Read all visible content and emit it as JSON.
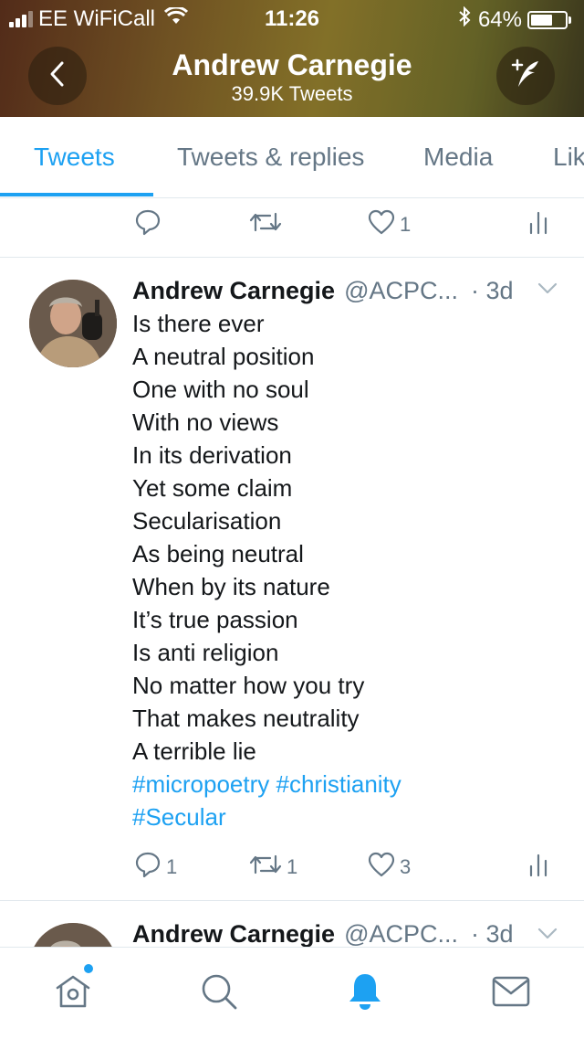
{
  "status_bar": {
    "carrier": "EE WiFiCall",
    "time": "11:26",
    "battery": "64%",
    "battery_level": 0.64
  },
  "header": {
    "title": "Andrew Carnegie",
    "subtitle": "39.9K Tweets",
    "back_icon": "chevron-left-icon",
    "compose_icon": "compose-feather-icon"
  },
  "tabs": [
    {
      "label": "Tweets",
      "active": true
    },
    {
      "label": "Tweets & replies",
      "active": false
    },
    {
      "label": "Media",
      "active": false
    },
    {
      "label": "Lik",
      "active": false
    }
  ],
  "previous_tweet_actions": {
    "reply_count": "",
    "retweet_count": "",
    "like_count": "1"
  },
  "tweet": {
    "name": "Andrew Carnegie",
    "handle": "@ACPC...",
    "time": "· 3d",
    "lines": [
      "Is there ever",
      "A neutral position",
      "One with no soul",
      "With no views",
      "In its derivation",
      "Yet some claim",
      "Secularisation",
      "As being neutral",
      "When by its nature",
      "It’s true passion",
      "Is anti religion",
      "No matter how you try",
      "That makes neutrality",
      "A terrible lie"
    ],
    "hashtags": [
      "#micropoetry #christianity",
      "#Secular"
    ],
    "reply_count": "1",
    "retweet_count": "1",
    "like_count": "3"
  },
  "next_tweet": {
    "name": "Andrew Carnegie",
    "handle": "@ACPC...",
    "time": "· 3d"
  },
  "bottom_nav": [
    {
      "icon": "home-icon",
      "active": false
    },
    {
      "icon": "search-icon",
      "active": false
    },
    {
      "icon": "notifications-bell-icon",
      "active": true
    },
    {
      "icon": "messages-envelope-icon",
      "active": false
    }
  ],
  "colors": {
    "accent": "#1da1f2",
    "secondary_text": "#657786",
    "divider": "#e1e8ed"
  }
}
